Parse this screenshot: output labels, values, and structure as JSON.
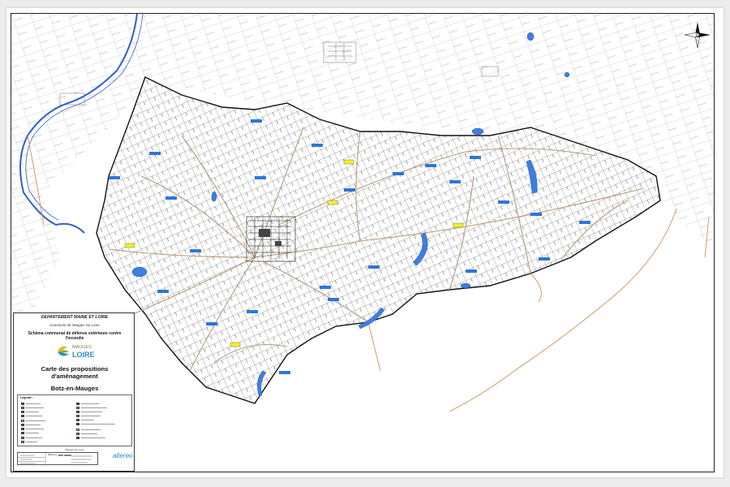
{
  "legend": {
    "department": "DEPARTEMENT MAINE ET LOIRE",
    "commune": "Commune de Mauges sur Loire",
    "schema_title": "Schéma communal de défense extérieure contre l'incendie",
    "logo_line1": "MAUGES",
    "logo_line2": "LOIRE",
    "map_title": "Carte des propositions d'aménagement",
    "place_name": "Botz-en-Mauges",
    "legend_heading": "Légende :",
    "footer_top": "Mauges sur Loire",
    "reference_label": "Référence :",
    "reference_value": "DPS 2665B",
    "consultant_logo": "altereo"
  },
  "colors": {
    "roads": "#b89a78",
    "river": "#2f5fc8",
    "water": "#3d7fe0",
    "parcels": "#1a1a1a",
    "outside_parcels": "#9a9a9a",
    "hydrant_label": "#2b78d6",
    "proposal_label": "#f2ee2a"
  }
}
